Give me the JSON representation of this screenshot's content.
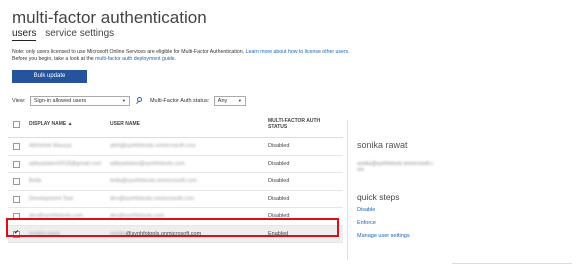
{
  "header": {
    "title": "multi-factor authentication",
    "tabs": [
      {
        "label": "users",
        "active": true
      },
      {
        "label": "service settings",
        "active": false
      }
    ]
  },
  "note": {
    "line1": "Note: only users licensed to use Microsoft Online Services are eligible for Multi-Factor Authentication.",
    "line1_link": "Learn more about how to license other users.",
    "line2": "Before you begin, take a look at the",
    "line2_link": "multi-factor auth deployment guide."
  },
  "toolbar": {
    "bulk_update": "Bulk update"
  },
  "filters": {
    "view_label": "View:",
    "view_value": "Sign-in allowed users",
    "status_label": "Multi-Factor Auth status:",
    "status_value": "Any"
  },
  "table": {
    "columns": {
      "display_name": "DISPLAY NAME",
      "sort_indicator": "▲",
      "user_name": "USER NAME",
      "mfa_status_line1": "MULTI-FACTOR AUTH",
      "mfa_status_line2": "STATUS"
    },
    "rows": [
      {
        "display_name": "Abhishek Maurya",
        "user_name": "abhi@synhfotools.onmicrosoft.com",
        "status": "Disabled",
        "selected": false,
        "obscured": true
      },
      {
        "display_name": "adityadalani2018@gmail.com",
        "user_name": "adityadalani@synhfotools.com",
        "status": "Disabled",
        "selected": false,
        "obscured": true
      },
      {
        "display_name": "Bella",
        "user_name": "bella@synhfotools.onmicrosoft.com",
        "status": "Disabled",
        "selected": false,
        "obscured": true
      },
      {
        "display_name": "Development Test",
        "user_name": "dev@synhfotools.onmicrosoft.com",
        "status": "Disabled",
        "selected": false,
        "obscured": true
      },
      {
        "display_name": "dev@synhfotools.com",
        "user_name": "dev@synhfotools.com",
        "status": "Disabled",
        "selected": false,
        "obscured": true
      },
      {
        "display_name": "sonika rawat",
        "user_name": "sonika@synhfotools.onmicrosoft.com",
        "user_name_prefix_obscured": "sonika",
        "user_name_suffix": "@synhfotools.onmicrosoft.com",
        "status": "Enabled",
        "selected": true,
        "obscured": false
      }
    ]
  },
  "details": {
    "name": "sonika rawat",
    "sub_line1": "sonika@synhfotools.onmicrosoft.c",
    "sub_line2": "om"
  },
  "quick_steps": {
    "title": "quick steps",
    "links": [
      "Disable",
      "Enforce",
      "Manage user settings"
    ]
  }
}
